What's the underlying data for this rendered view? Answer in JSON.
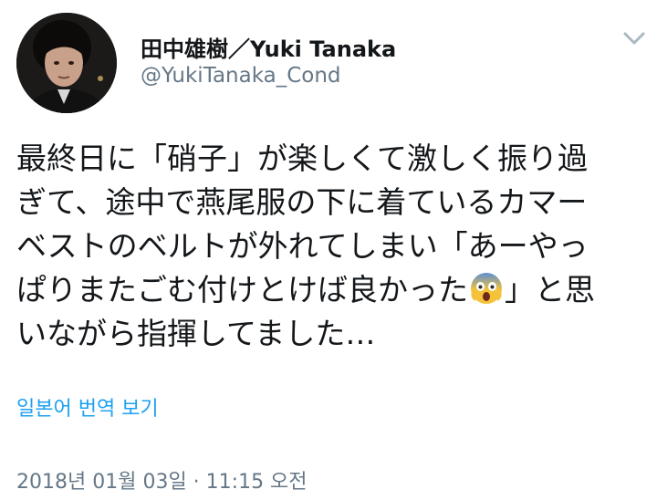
{
  "author": {
    "display_name": "田中雄樹／Yuki Tanaka",
    "handle": "@YukiTanaka_Cond",
    "avatar_icon": "profile-photo"
  },
  "tweet": {
    "lines": [
      "最終日に「硝子」が楽しくて激しく振り過",
      "ぎて、途中で燕尾服の下に着ているカマー",
      "ベストのベルトが外れてしまい「あーやっ",
      "ぱりまたごむ付けとけば良かった",
      "」と思",
      "いながら指揮してました…"
    ],
    "emoji_icon": "face-screaming-in-fear-icon"
  },
  "translate_label": "일본어 번역 보기",
  "timestamp": "2018년 01월 03일 · 11:15 오전",
  "colors": {
    "link": "#1da1f2",
    "secondary_text": "#657786",
    "primary_text": "#14171a"
  }
}
